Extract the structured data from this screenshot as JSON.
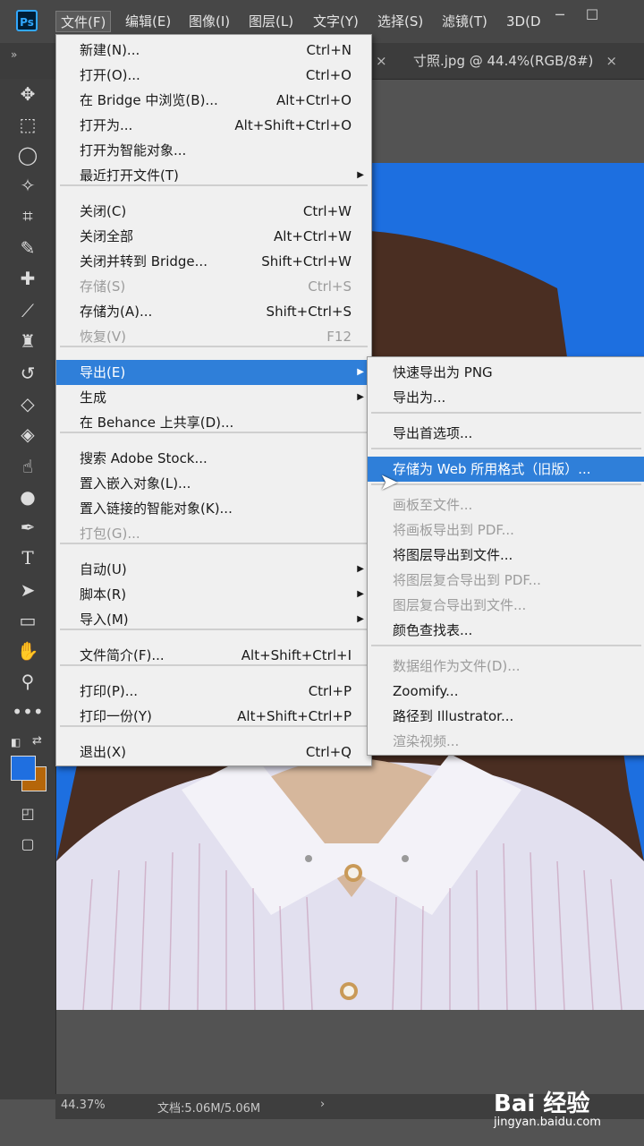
{
  "app": {
    "logo": "Ps"
  },
  "menubar": [
    "文件(F)",
    "编辑(E)",
    "图像(I)",
    "图层(L)",
    "文字(Y)",
    "选择(S)",
    "滤镜(T)",
    "3D(D"
  ],
  "window_controls": [
    "─",
    "☐"
  ],
  "tabs": [
    {
      "label": "寸照.jpg @ 44.4%(RGB/8#)"
    }
  ],
  "tab_close": "×",
  "file_menu": [
    {
      "label": "新建(N)...",
      "shortcut": "Ctrl+N"
    },
    {
      "label": "打开(O)...",
      "shortcut": "Ctrl+O"
    },
    {
      "label": "在 Bridge 中浏览(B)...",
      "shortcut": "Alt+Ctrl+O"
    },
    {
      "label": "打开为...",
      "shortcut": "Alt+Shift+Ctrl+O"
    },
    {
      "label": "打开为智能对象...",
      "shortcut": ""
    },
    {
      "label": "最近打开文件(T)",
      "shortcut": "",
      "submenu": true
    },
    {
      "label": "关闭(C)",
      "shortcut": "Ctrl+W"
    },
    {
      "label": "关闭全部",
      "shortcut": "Alt+Ctrl+W"
    },
    {
      "label": "关闭并转到 Bridge...",
      "shortcut": "Shift+Ctrl+W"
    },
    {
      "label": "存储(S)",
      "shortcut": "Ctrl+S",
      "disabled": true
    },
    {
      "label": "存储为(A)...",
      "shortcut": "Shift+Ctrl+S"
    },
    {
      "label": "恢复(V)",
      "shortcut": "F12",
      "disabled": true
    },
    {
      "label": "导出(E)",
      "shortcut": "",
      "submenu": true,
      "highlighted": true
    },
    {
      "label": "生成",
      "shortcut": "",
      "submenu": true
    },
    {
      "label": "在 Behance 上共享(D)...",
      "shortcut": ""
    },
    {
      "label": "搜索 Adobe Stock...",
      "shortcut": ""
    },
    {
      "label": "置入嵌入对象(L)...",
      "shortcut": ""
    },
    {
      "label": "置入链接的智能对象(K)...",
      "shortcut": ""
    },
    {
      "label": "打包(G)...",
      "shortcut": "",
      "disabled": true
    },
    {
      "label": "自动(U)",
      "shortcut": "",
      "submenu": true
    },
    {
      "label": "脚本(R)",
      "shortcut": "",
      "submenu": true
    },
    {
      "label": "导入(M)",
      "shortcut": "",
      "submenu": true
    },
    {
      "label": "文件简介(F)...",
      "shortcut": "Alt+Shift+Ctrl+I"
    },
    {
      "label": "打印(P)...",
      "shortcut": "Ctrl+P"
    },
    {
      "label": "打印一份(Y)",
      "shortcut": "Alt+Shift+Ctrl+P"
    },
    {
      "label": "退出(X)",
      "shortcut": "Ctrl+Q"
    }
  ],
  "export_submenu": [
    {
      "label": "快速导出为 PNG"
    },
    {
      "label": "导出为..."
    },
    {
      "label": "导出首选项..."
    },
    {
      "label": "存储为 Web 所用格式（旧版）...",
      "highlighted": true
    },
    {
      "label": "画板至文件...",
      "disabled": true
    },
    {
      "label": "将画板导出到 PDF...",
      "disabled": true
    },
    {
      "label": "将图层导出到文件..."
    },
    {
      "label": "将图层复合导出到 PDF...",
      "disabled": true
    },
    {
      "label": "图层复合导出到文件...",
      "disabled": true
    },
    {
      "label": "颜色查找表..."
    },
    {
      "label": "数据组作为文件(D)...",
      "disabled": true
    },
    {
      "label": "Zoomify..."
    },
    {
      "label": "路径到 Illustrator..."
    },
    {
      "label": "渲染视频...",
      "disabled": true
    }
  ],
  "tools": [
    "move-icon",
    "marquee-icon",
    "lasso-icon",
    "magic-wand-icon",
    "crop-icon",
    "eyedropper-icon",
    "spot-heal-icon",
    "brush-icon",
    "stamp-icon",
    "history-brush-icon",
    "eraser-icon",
    "fill-icon",
    "smudge-icon",
    "dodge-icon",
    "pen-icon",
    "type-icon",
    "path-select-icon",
    "rectangle-icon",
    "hand-icon",
    "zoom-icon",
    "more-icon"
  ],
  "colors": {
    "foreground": "#1f6fe0",
    "background": "#b5660a",
    "canvas": "#1d6fe0",
    "menu_highlight": "#2f7fd9"
  },
  "status": {
    "zoom": "44.37%",
    "doc": "文档:5.06M/5.06M",
    "arrow": "›"
  },
  "watermark": {
    "brand": "Bai 经验",
    "url": "jingyan.baidu.com"
  }
}
